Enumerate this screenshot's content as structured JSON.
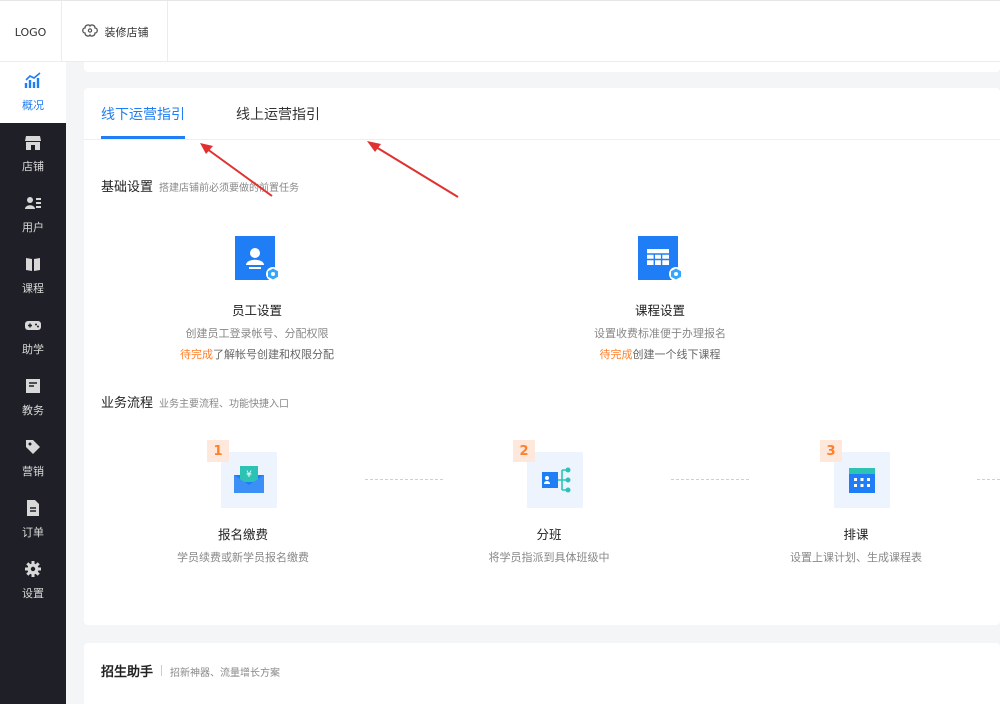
{
  "header": {
    "logo": "LOGO",
    "decorate_label": "装修店铺"
  },
  "sidebar": {
    "items": [
      {
        "label": "概况",
        "icon": "chart-trend-icon",
        "active": true
      },
      {
        "label": "店铺",
        "icon": "store-icon"
      },
      {
        "label": "用户",
        "icon": "users-icon"
      },
      {
        "label": "课程",
        "icon": "book-icon"
      },
      {
        "label": "助学",
        "icon": "gamepad-icon"
      },
      {
        "label": "教务",
        "icon": "board-icon"
      },
      {
        "label": "营销",
        "icon": "tag-icon"
      },
      {
        "label": "订单",
        "icon": "document-icon"
      },
      {
        "label": "设置",
        "icon": "gear-icon"
      }
    ]
  },
  "tabs": [
    {
      "label": "线下运营指引",
      "active": true
    },
    {
      "label": "线上运营指引",
      "active": false
    }
  ],
  "basic": {
    "title": "基础设置",
    "subtitle": "搭建店铺前必须要做的前置任务",
    "cards": [
      {
        "name": "员工设置",
        "desc": "创建员工登录帐号、分配权限",
        "status": "待完成",
        "status_rest": "了解帐号创建和权限分配",
        "icon": "staff-icon"
      },
      {
        "name": "课程设置",
        "desc": "设置收费标准便于办理报名",
        "status": "待完成",
        "status_rest": "创建一个线下课程",
        "icon": "course-grid-icon"
      }
    ]
  },
  "process": {
    "title": "业务流程",
    "subtitle": "业务主要流程、功能快捷入口",
    "steps": [
      {
        "num": "1",
        "name": "报名缴费",
        "desc": "学员续费或新学员报名缴费",
        "icon": "payment-envelope-icon"
      },
      {
        "num": "2",
        "name": "分班",
        "desc": "将学员指派到具体班级中",
        "icon": "class-branch-icon"
      },
      {
        "num": "3",
        "name": "排课",
        "desc": "设置上课计划、生成课程表",
        "icon": "calendar-icon"
      }
    ]
  },
  "recruit": {
    "title": "招生助手",
    "subtitle": "招新神器、流量增长方案"
  },
  "colors": {
    "accent": "#1f7ef6",
    "pending": "#ff7f2a",
    "sidebar_bg": "#1f2027",
    "annotation_arrow": "#e0302f"
  }
}
